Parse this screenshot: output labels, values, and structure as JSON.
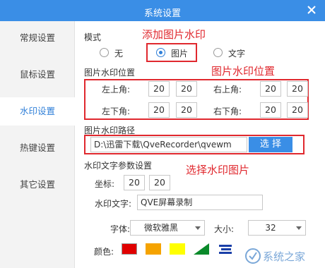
{
  "window": {
    "title": "系统设置"
  },
  "sidebar": {
    "items": [
      {
        "label": "常规设置"
      },
      {
        "label": "鼠标设置"
      },
      {
        "label": "水印设置"
      },
      {
        "label": "热键设置"
      },
      {
        "label": "其它设置"
      }
    ],
    "active_index": 2
  },
  "mode": {
    "label": "模式",
    "options": [
      "无",
      "图片",
      "文字"
    ],
    "selected": "图片"
  },
  "image_position": {
    "label": "图片水印位置",
    "top_left": {
      "label": "左上角:",
      "x": "20",
      "y": "20"
    },
    "top_right": {
      "label": "右上角:",
      "x": "20",
      "y": "20"
    },
    "bottom_left": {
      "label": "左下角:",
      "x": "20",
      "y": "20"
    },
    "bottom_right": {
      "label": "右下角:",
      "x": "20",
      "y": "20"
    }
  },
  "image_path": {
    "label": "图片水印路径",
    "value": "D:\\迅雷下载\\QveRecorder\\qvewm",
    "select_button": "选 择"
  },
  "text_params": {
    "label": "水印文字参数设置",
    "coord_label": "坐标:",
    "coord_x": "20",
    "coord_y": "20",
    "text_label": "水印文字:",
    "text_value": "QVE屏幕录制",
    "font_label": "字体:",
    "font_value": "微软雅黑",
    "size_label": "大小:",
    "size_value": "32",
    "color_label": "颜色:",
    "swatches": [
      "#e00000",
      "#f5a300",
      "#ffff00",
      "#0a8a2a",
      "#1a3fa8"
    ]
  },
  "annotations": {
    "add_image": "添加图片水印",
    "image_position": "图片水印位置",
    "select_image": "选择水印图片"
  },
  "watermark": {
    "text": "系统之家"
  },
  "colors": {
    "accent": "#3a8ee6",
    "annotation": "#e0282e"
  }
}
